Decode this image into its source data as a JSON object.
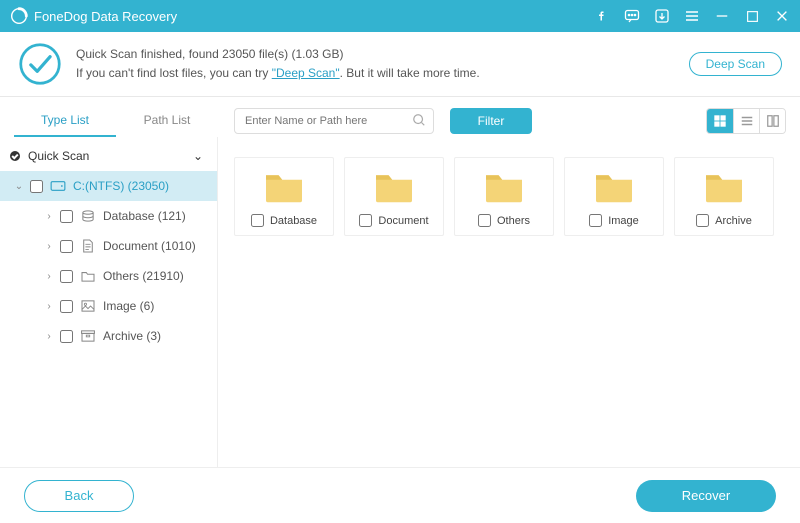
{
  "titlebar": {
    "app_name": "FoneDog Data Recovery"
  },
  "banner": {
    "line1_prefix": "Quick Scan finished, found ",
    "file_count": "23050",
    "line1_mid": " file(s) ",
    "total_size": "(1.03 GB)",
    "line2_prefix": "If you can't find lost files, you can try ",
    "deep_scan_link": "\"Deep Scan\"",
    "line2_suffix": ". But it will take more time.",
    "deep_scan_btn": "Deep Scan"
  },
  "tabs": {
    "type_list": "Type List",
    "path_list": "Path List"
  },
  "search": {
    "placeholder": "Enter Name or Path here"
  },
  "filter_btn": "Filter",
  "tree": {
    "root": "Quick Scan",
    "drive": "C:(NTFS) (23050)",
    "children": [
      {
        "label": "Database (121)",
        "icon": "database"
      },
      {
        "label": "Document (1010)",
        "icon": "document"
      },
      {
        "label": "Others (21910)",
        "icon": "folder"
      },
      {
        "label": "Image (6)",
        "icon": "image"
      },
      {
        "label": "Archive (3)",
        "icon": "archive"
      }
    ]
  },
  "grid_items": [
    {
      "name": "Database"
    },
    {
      "name": "Document"
    },
    {
      "name": "Others"
    },
    {
      "name": "Image"
    },
    {
      "name": "Archive"
    }
  ],
  "footer": {
    "back": "Back",
    "recover": "Recover"
  },
  "colors": {
    "accent": "#33b3d0"
  }
}
